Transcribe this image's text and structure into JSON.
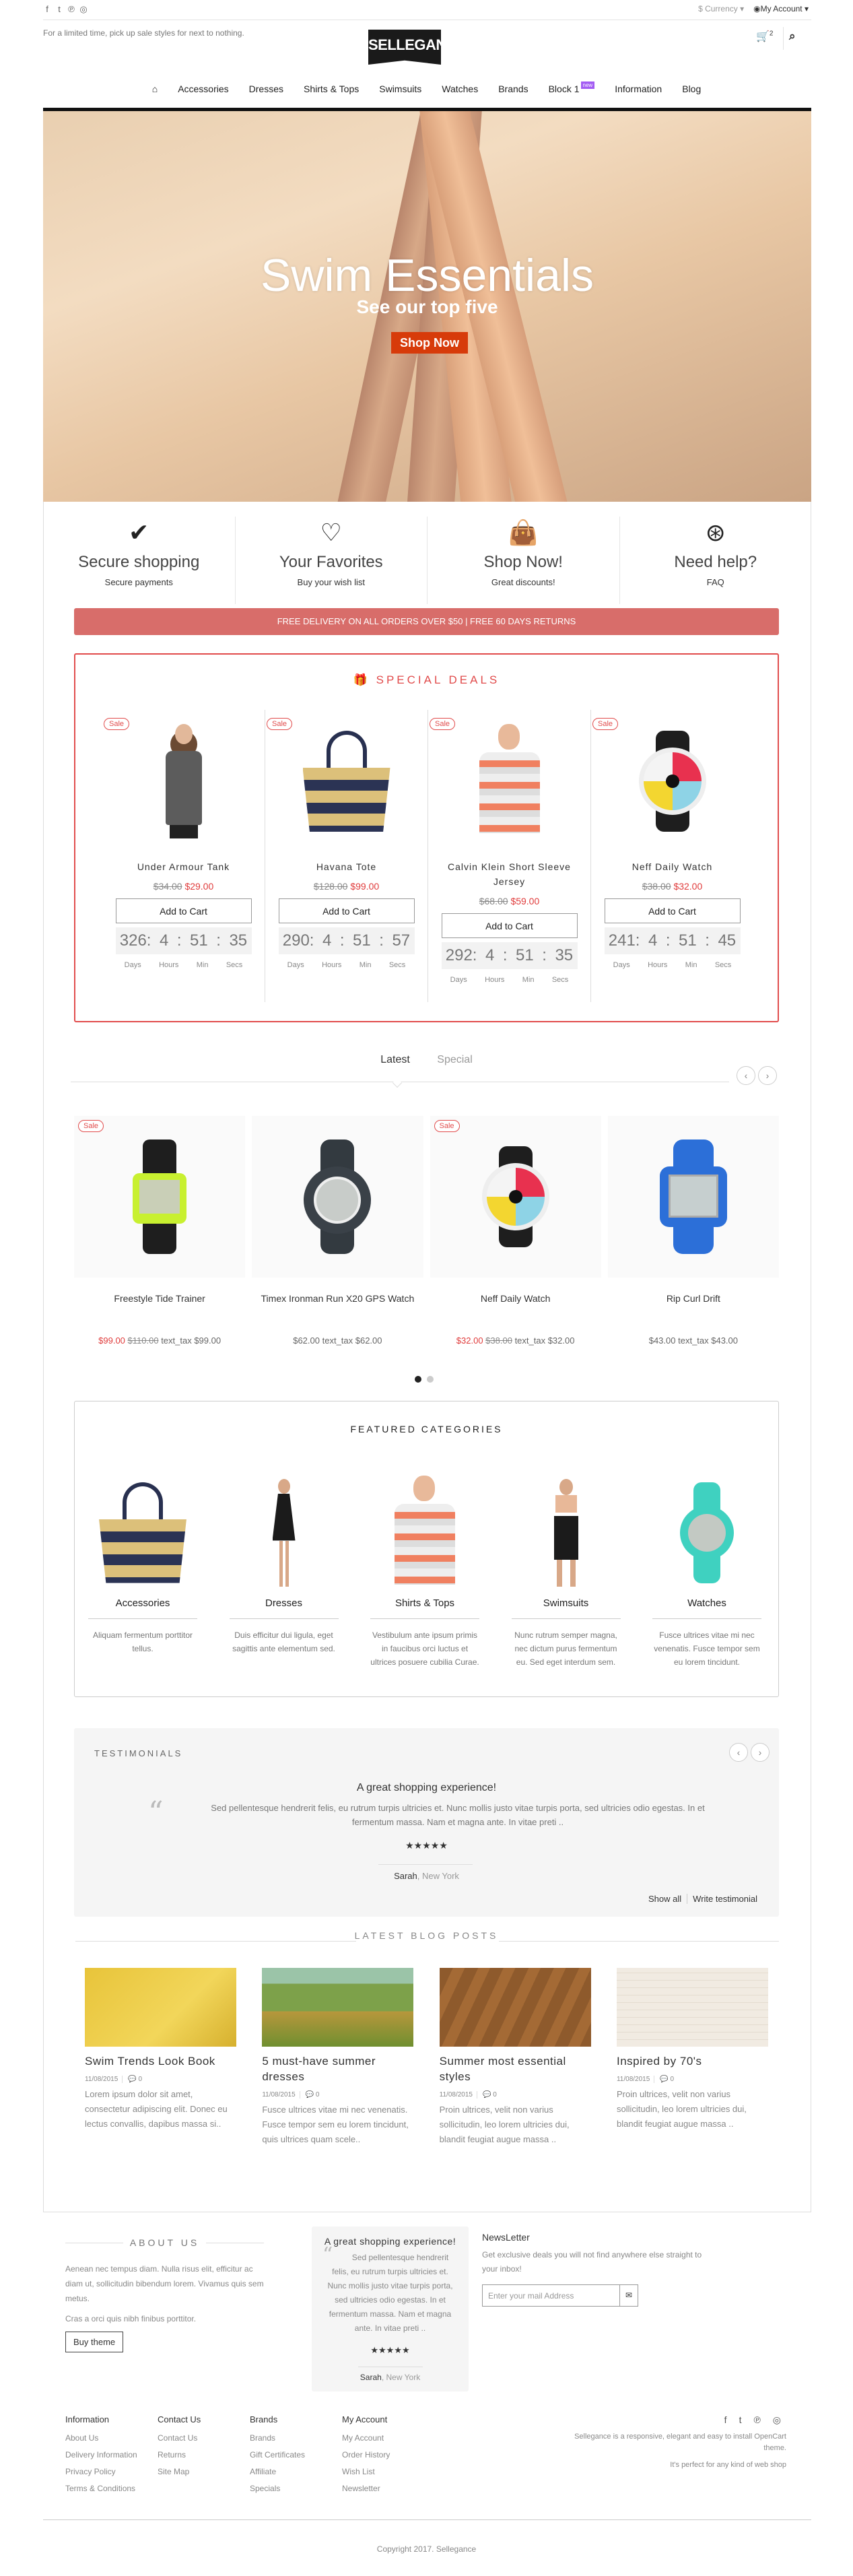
{
  "topbar": {
    "social_icons": [
      "facebook-icon",
      "twitter-icon",
      "pinterest-icon",
      "instagram-icon"
    ],
    "currency_label": "$ Currency ▾",
    "account_label": "My Account ▾"
  },
  "header": {
    "tagline": "For a limited time, pick up sale styles for next to nothing.",
    "logo_text": "SELLEGANCE",
    "cart_count": "2"
  },
  "nav": {
    "home_icon": "home-icon",
    "items": [
      "Accessories",
      "Dresses",
      "Shirts & Tops",
      "Swimsuits",
      "Watches",
      "Brands",
      "Block 1",
      "Information",
      "Blog"
    ],
    "badge": "new"
  },
  "hero": {
    "title": "Swim Essentials",
    "subtitle": "See our top five",
    "button": "Shop Now"
  },
  "features": [
    {
      "icon": "check-circle-icon",
      "title": "Secure shopping",
      "sub": "Secure payments"
    },
    {
      "icon": "heart-icon",
      "title": "Your Favorites",
      "sub": "Buy your wish list"
    },
    {
      "icon": "shopping-bag-icon",
      "title": "Shop Now!",
      "sub": "Great discounts!"
    },
    {
      "icon": "life-ring-icon",
      "title": "Need help?",
      "sub": "FAQ"
    }
  ],
  "delivery_banner": "FREE DELIVERY ON ALL ORDERS OVER $50 | FREE 60 DAYS RETURNS",
  "special_deals": {
    "title": "SPECIAL DEALS",
    "sale_label": "Sale",
    "add_to_cart": "Add to Cart",
    "timer_labels": [
      "Days",
      "Hours",
      "Min",
      "Secs"
    ],
    "items": [
      {
        "name": "Under Armour Tank",
        "old_price": "$34.00",
        "price": "$29.00",
        "days": "326:",
        "hours": "4",
        "min": "51",
        "secs": "35"
      },
      {
        "name": "Havana Tote",
        "old_price": "$128.00",
        "price": "$99.00",
        "days": "290:",
        "hours": "4",
        "min": "51",
        "secs": "57"
      },
      {
        "name": "Calvin Klein Short Sleeve Jersey",
        "old_price": "$68.00",
        "price": "$59.00",
        "days": "292:",
        "hours": "4",
        "min": "51",
        "secs": "35"
      },
      {
        "name": "Neff Daily Watch",
        "old_price": "$38.00",
        "price": "$32.00",
        "days": "241:",
        "hours": "4",
        "min": "51",
        "secs": "45"
      }
    ]
  },
  "latest": {
    "tabs": [
      "Latest",
      "Special"
    ],
    "active_tab": "Latest",
    "sale_label": "Sale",
    "items": [
      {
        "name": "Freestyle Tide Trainer",
        "special": "$99.00",
        "old": "$110.00",
        "tax": "text_tax $99.00",
        "sale": true
      },
      {
        "name": "Timex Ironman Run X20 GPS Watch",
        "special": "",
        "old": "",
        "price": "$62.00",
        "tax": "text_tax $62.00",
        "sale": false
      },
      {
        "name": "Neff Daily Watch",
        "special": "$32.00",
        "old": "$38.00",
        "tax": "text_tax $32.00",
        "sale": true
      },
      {
        "name": "Rip Curl Drift",
        "special": "",
        "old": "",
        "price": "$43.00",
        "tax": "text_tax $43.00",
        "sale": false
      }
    ],
    "pagination": {
      "pages": 2,
      "current": 1
    }
  },
  "featured_categories": {
    "title": "FEATURED CATEGORIES",
    "items": [
      {
        "name": "Accessories",
        "desc": "Aliquam fermentum porttitor tellus."
      },
      {
        "name": "Dresses",
        "desc": "Duis efficitur dui ligula, eget sagittis ante elementum sed."
      },
      {
        "name": "Shirts & Tops",
        "desc": "Vestibulum ante ipsum primis in faucibus orci luctus et ultrices posuere cubilia Curae."
      },
      {
        "name": "Swimsuits",
        "desc": "Nunc rutrum semper magna, nec dictum purus fermentum eu. Sed eget interdum sem."
      },
      {
        "name": "Watches",
        "desc": "Fusce ultrices vitae mi nec venenatis. Fusce tempor sem eu lorem tincidunt."
      }
    ]
  },
  "testimonials": {
    "title": "TESTIMONIALS",
    "headline": "A great shopping experience!",
    "body": "Sed pellentesque hendrerit felis, eu rutrum turpis ultricies et. Nunc mollis justo vitae turpis porta, sed ultricies odio egestas. In et fermentum massa. Nam et magna ante. In vitae preti ..",
    "rating": 5,
    "stars": "★★★★★",
    "author": "Sarah",
    "location": ", New York",
    "show_all": "Show all",
    "write": "Write testimonial"
  },
  "blog": {
    "title": "LATEST BLOG POSTS",
    "posts": [
      {
        "title": "Swim Trends Look Book",
        "date": "11/08/2015",
        "comments": "0",
        "excerpt": "Lorem ipsum dolor sit amet, consectetur adipiscing elit. Donec eu lectus convallis, dapibus massa si.."
      },
      {
        "title": "5 must-have summer dresses",
        "date": "11/08/2015",
        "comments": "0",
        "excerpt": "Fusce ultrices vitae mi nec venenatis. Fusce tempor sem eu lorem tincidunt, quis ultrices quam scele.."
      },
      {
        "title": "Summer most essential styles",
        "date": "11/08/2015",
        "comments": "0",
        "excerpt": "Proin ultrices, velit non varius sollicitudin, leo lorem ultricies dui, blandit feugiat augue massa .."
      },
      {
        "title": "Inspired by 70's",
        "date": "11/08/2015",
        "comments": "0",
        "excerpt": "Proin ultrices, velit non varius sollicitudin, leo lorem ultricies dui, blandit feugiat augue massa .."
      }
    ]
  },
  "footer": {
    "about_title": "ABOUT US",
    "about_p1": "Aenean nec tempus diam. Nulla risus elit, efficitur ac diam ut, sollicitudin bibendum lorem. Vivamus quis sem metus.",
    "about_p2": "Cras a orci quis nibh finibus porttitor.",
    "buy_theme": "Buy theme",
    "testimonial": {
      "headline": "A great shopping experience!",
      "body": "Sed pellentesque hendrerit felis, eu rutrum turpis ultricies et. Nunc mollis justo vitae turpis porta, sed ultricies odio egestas. In et fermentum massa. Nam et magna ante. In vitae preti ..",
      "stars": "★★★★★",
      "author": "Sarah",
      "location": ", New York"
    },
    "newsletter": {
      "title": "NewsLetter",
      "text": "Get exclusive deals you will not find anywhere else straight to your inbox!",
      "placeholder": "Enter your mail Address"
    },
    "columns": [
      {
        "title": "Information",
        "links": [
          "About Us",
          "Delivery Information",
          "Privacy Policy",
          "Terms & Conditions"
        ]
      },
      {
        "title": "Contact Us",
        "links": [
          "Contact Us",
          "Returns",
          "Site Map"
        ]
      },
      {
        "title": "Brands",
        "links": [
          "Brands",
          "Gift Certificates",
          "Affiliate",
          "Specials"
        ]
      },
      {
        "title": "My Account",
        "links": [
          "My Account",
          "Order History",
          "Wish List",
          "Newsletter"
        ]
      }
    ],
    "desc1": "Sellegance is a responsive, elegant and easy to install OpenCart theme.",
    "desc2": "It's perfect for any kind of web shop",
    "copyright": "Copyright 2017. Sellegance"
  },
  "colors": {
    "accent": "#e14b4b",
    "delivery": "#d86d6a",
    "shop_now": "#d73b0a",
    "badge": "#a35cf3"
  }
}
